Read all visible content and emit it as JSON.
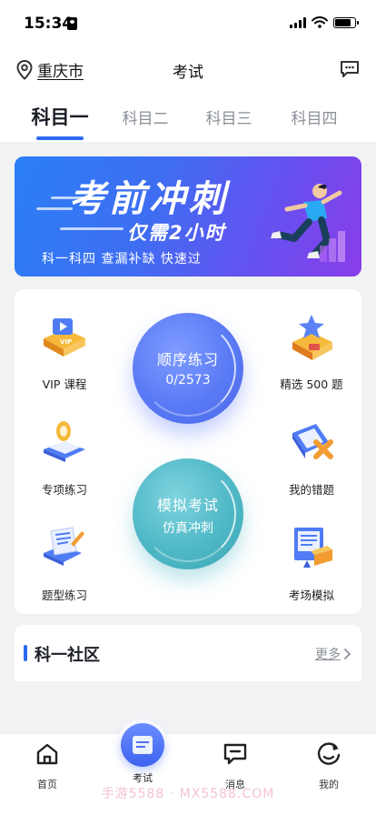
{
  "status_bar": {
    "time": "15:34",
    "battery_level": 0.8
  },
  "header": {
    "city": "重庆市",
    "title": "考试",
    "icons": {
      "location": "location-pin-icon",
      "message": "chat-bubble-icon"
    }
  },
  "tabs": [
    {
      "label": "科目一",
      "active": true
    },
    {
      "label": "科目二",
      "active": false
    },
    {
      "label": "科目三",
      "active": false
    },
    {
      "label": "科目四",
      "active": false
    }
  ],
  "banner": {
    "title": "考前冲刺",
    "subtitle": "仅需2小时",
    "tagline": "科一科四  查漏补缺  快速过"
  },
  "practice": {
    "sequential": {
      "title": "顺序练习",
      "progress": "0/2573"
    },
    "mock": {
      "title": "模拟考试",
      "subtitle": "仿真冲刺"
    },
    "features": [
      {
        "label": "VIP 课程",
        "icon": "vip-course-icon"
      },
      {
        "label": "精选 500 题",
        "icon": "star-selection-icon"
      },
      {
        "label": "专项练习",
        "icon": "special-practice-icon"
      },
      {
        "label": "我的错题",
        "icon": "wrong-questions-icon"
      },
      {
        "label": "题型练习",
        "icon": "question-type-icon"
      },
      {
        "label": "考场模拟",
        "icon": "exam-simulation-icon"
      }
    ]
  },
  "community": {
    "title": "科一社区",
    "more": "更多"
  },
  "bottom_nav": [
    {
      "label": "首页",
      "icon": "home-icon"
    },
    {
      "label": "考试",
      "icon": "exam-icon",
      "active": true
    },
    {
      "label": "消息",
      "icon": "message-icon"
    },
    {
      "label": "我的",
      "icon": "profile-icon"
    }
  ],
  "watermark": "手游5588 · MX5588.COM",
  "colors": {
    "accent": "#2f6bf2",
    "sequential": "#5a7af5",
    "mock": "#4fb8c6"
  }
}
